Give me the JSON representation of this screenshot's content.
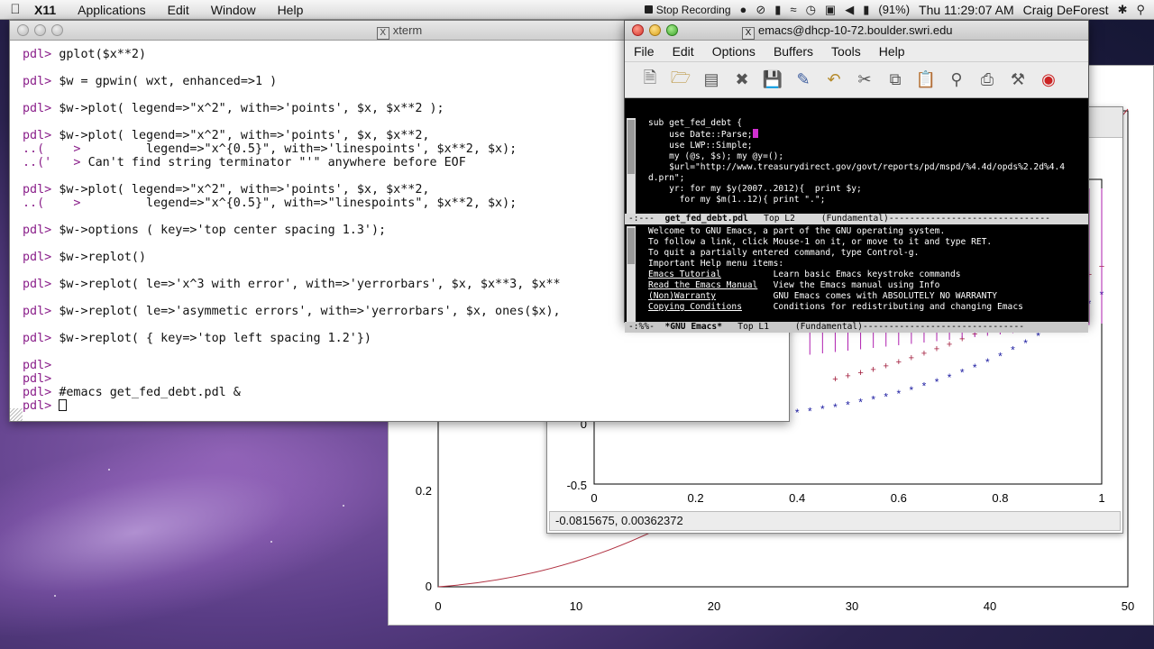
{
  "menubar": {
    "app_name": "X11",
    "menus": [
      "Applications",
      "Edit",
      "Window",
      "Help"
    ],
    "stop_recording": "Stop Recording",
    "battery": "(91%)",
    "clock": "Thu 11:29:07 AM",
    "user": "Craig DeForest"
  },
  "xterm": {
    "title": "xterm",
    "lines": [
      {
        "p": "pdl> ",
        "t": "gplot($x**2)"
      },
      {
        "p": "",
        "t": ""
      },
      {
        "p": "pdl> ",
        "t": "$w = gpwin( wxt, enhanced=>1 )"
      },
      {
        "p": "",
        "t": ""
      },
      {
        "p": "pdl> ",
        "t": "$w->plot( legend=>\"x^2\", with=>'points', $x, $x**2 );"
      },
      {
        "p": "",
        "t": ""
      },
      {
        "p": "pdl> ",
        "t": "$w->plot( legend=>\"x^2\", with=>'points', $x, $x**2,"
      },
      {
        "p": "..(    > ",
        "t": "        legend=>\"x^{0.5}\", with=>'linespoints', $x**2, $x);"
      },
      {
        "p": "..('   > ",
        "t": "Can't find string terminator \"'\" anywhere before EOF"
      },
      {
        "p": "",
        "t": ""
      },
      {
        "p": "pdl> ",
        "t": "$w->plot( legend=>\"x^2\", with=>'points', $x, $x**2,"
      },
      {
        "p": "..(    > ",
        "t": "        legend=>\"x^{0.5}\", with=>\"linespoints\", $x**2, $x);"
      },
      {
        "p": "",
        "t": ""
      },
      {
        "p": "pdl> ",
        "t": "$w->options ( key=>'top center spacing 1.3');"
      },
      {
        "p": "",
        "t": ""
      },
      {
        "p": "pdl> ",
        "t": "$w->replot()"
      },
      {
        "p": "",
        "t": ""
      },
      {
        "p": "pdl> ",
        "t": "$w->replot( le=>'x^3 with error', with=>'yerrorbars', $x, $x**3, $x**"
      },
      {
        "p": "",
        "t": ""
      },
      {
        "p": "pdl> ",
        "t": "$w->replot( le=>'asymmetic errors', with=>'yerrorbars', $x, ones($x),"
      },
      {
        "p": "",
        "t": ""
      },
      {
        "p": "pdl> ",
        "t": "$w->replot( { key=>'top left spacing 1.2'})"
      },
      {
        "p": "",
        "t": ""
      },
      {
        "p": "pdl> ",
        "t": ""
      },
      {
        "p": "pdl> ",
        "t": ""
      },
      {
        "p": "pdl> ",
        "t": "#emacs get_fed_debt.pdl &"
      },
      {
        "p": "pdl> ",
        "t": ""
      }
    ]
  },
  "emacs": {
    "title": "emacs@dhcp-10-72.boulder.swri.edu",
    "menus": [
      "File",
      "Edit",
      "Options",
      "Buffers",
      "Tools",
      "Help"
    ],
    "code_lines": [
      "sub get_fed_debt {",
      "    use Date::Parse;",
      "    use LWP::Simple;",
      "    my (@s, $s); my @y=();",
      "",
      "    $url=\"http://www.treasurydirect.gov/govt/reports/pd/mspd/%4.4d/opds%2.2d%4.4",
      "d.prn\";",
      "    yr: for my $y(2007..2012){  print $y;",
      "      for my $m(1..12){ print \".\";"
    ],
    "modeline1": {
      "prefix": "-:---  ",
      "buffer": "get_fed_debt.pdl",
      "pos": "   Top L2     ",
      "mode": "(Fundamental)-------------------------------"
    },
    "help_lines": [
      "Welcome to GNU Emacs, a part of the GNU operating system.",
      "To follow a link, click Mouse-1 on it, or move to it and type RET.",
      "To quit a partially entered command, type Control-g.",
      "",
      "Important Help menu items:"
    ],
    "help_items": [
      {
        "link": "Emacs Tutorial",
        "desc": "Learn basic Emacs keystroke commands"
      },
      {
        "link": "Read the Emacs Manual",
        "desc": "View the Emacs manual using Info"
      },
      {
        "link": "(Non)Warranty",
        "desc": "GNU Emacs comes with ABSOLUTELY NO WARRANTY"
      },
      {
        "link": "Copying Conditions",
        "desc": "Conditions for redistributing and changing Emacs"
      }
    ],
    "modeline2": {
      "prefix": "-:%%-  ",
      "buffer": "*GNU Emacs*",
      "pos": "   Top L1     ",
      "mode": "(Fundamental)-------------------------------"
    }
  },
  "plot_back": {
    "x_ticks": [
      "0",
      "10",
      "20",
      "30",
      "40",
      "50"
    ],
    "y_ticks": [
      "0",
      "0.2"
    ]
  },
  "plot_inner": {
    "x_ticks": [
      "0",
      "0.2",
      "0.4",
      "0.6",
      "0.8",
      "1"
    ],
    "y_ticks": [
      "0",
      "-0.5"
    ],
    "status": "-0.0815675,  0.00362372"
  }
}
